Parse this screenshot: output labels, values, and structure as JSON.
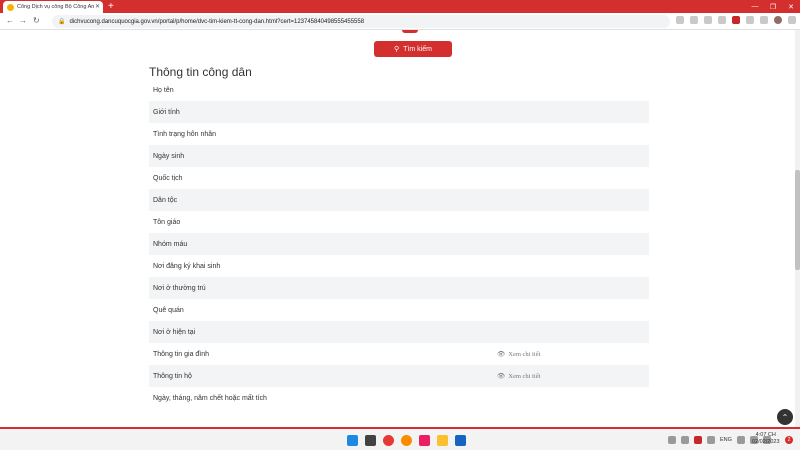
{
  "browser": {
    "tab_title": "Cổng Dịch vụ công Bộ Công An",
    "tab_close": "✕",
    "new_tab": "+",
    "url": "dichvucong.dancuquocgia.gov.vn/portal/p/home/dvc-tim-kiem-tt-cong-dan.html?cert=123745840498555455558"
  },
  "search": {
    "button_label": "Tìm kiếm"
  },
  "citizen_info": {
    "title": "Thông tin công dân",
    "rows": [
      {
        "label": "Họ tên",
        "link": ""
      },
      {
        "label": "Giới tính",
        "link": ""
      },
      {
        "label": "Tình trạng hôn nhân",
        "link": ""
      },
      {
        "label": "Ngày sinh",
        "link": ""
      },
      {
        "label": "Quốc tịch",
        "link": ""
      },
      {
        "label": "Dân tộc",
        "link": ""
      },
      {
        "label": "Tôn giáo",
        "link": ""
      },
      {
        "label": "Nhóm máu",
        "link": ""
      },
      {
        "label": "Nơi đăng ký khai sinh",
        "link": ""
      },
      {
        "label": "Nơi ở thường trú",
        "link": ""
      },
      {
        "label": "Quê quán",
        "link": ""
      },
      {
        "label": "Nơi ở hiện tại",
        "link": ""
      },
      {
        "label": "Thông tin gia đình",
        "link": "Xem chi tiết"
      },
      {
        "label": "Thông tin hộ",
        "link": "Xem chi tiết"
      },
      {
        "label": "Ngày, tháng, năm chết hoặc mất tích",
        "link": ""
      }
    ]
  },
  "taskbar": {
    "language": "ENG",
    "time": "4:07 CH",
    "date": "02/02/2023",
    "notification_count": "2"
  },
  "colors": {
    "brand_red": "#d32f2f",
    "row_alt": "#f3f4f6"
  }
}
